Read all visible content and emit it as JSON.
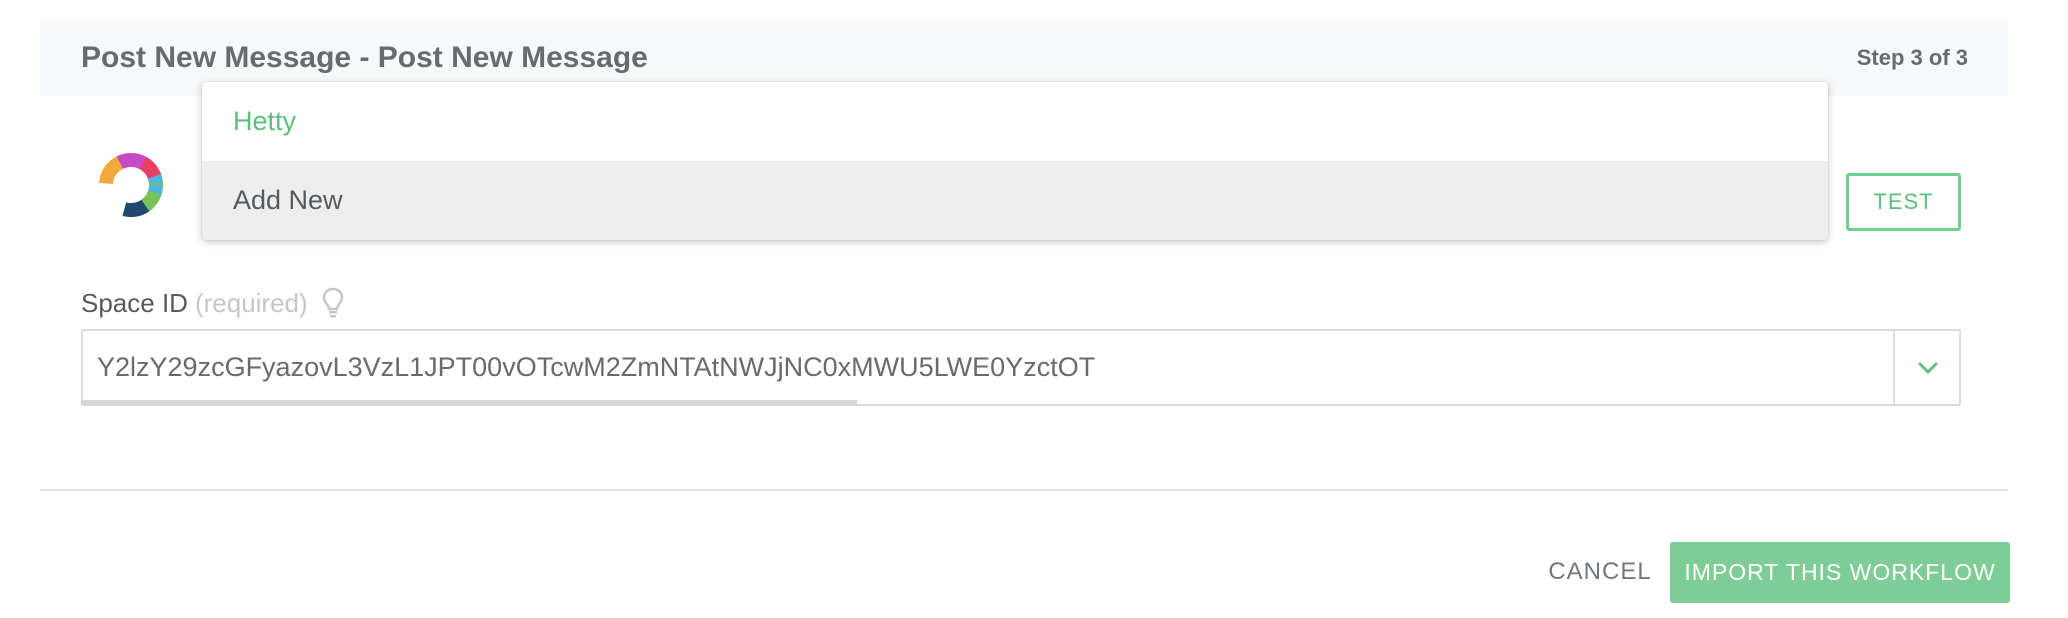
{
  "header": {
    "title": "Post New Message - Post New Message",
    "step": "Step 3 of 3"
  },
  "app": {
    "logo_icon": "webex-teams-logo"
  },
  "account_dropdown": {
    "options": [
      {
        "label": "Hetty",
        "state": "selected"
      },
      {
        "label": "Add New",
        "state": "hovered"
      }
    ]
  },
  "test_button": {
    "label": "TEST"
  },
  "space_field": {
    "label": "Space ID",
    "required_text": "(required)",
    "hint_icon": "lightbulb-icon",
    "value": "Y2lzY29zcGFyazovL3VzL1JPT00vOTcwM2ZmNTAtNWJjNC0xMWU5LWE0YzctOT",
    "chevron_icon": "chevron-down-icon"
  },
  "footer": {
    "cancel_label": "CANCEL",
    "import_label": "IMPORT THIS WORKFLOW"
  },
  "colors": {
    "accent_green": "#5cbf7c",
    "button_green": "#7fcd96",
    "text_gray": "#666b70"
  }
}
